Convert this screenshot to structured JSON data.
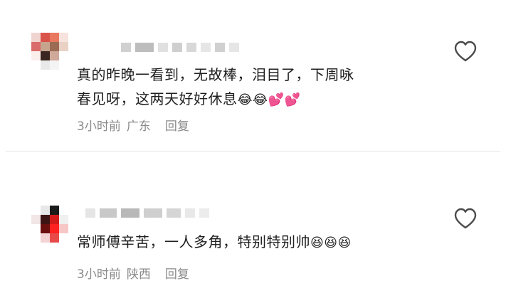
{
  "comments": [
    {
      "text_line1": "真的昨晚一看到，无故棒，泪目了，下周咏",
      "text_line2": "春见呀，这两天好好休息",
      "emojis": [
        "😂",
        "😂",
        "💕",
        "💕"
      ],
      "time": "3小时前",
      "location": "广东",
      "reply": "回复",
      "icons": {
        "like": "heart-outline-icon",
        "avatar": "pixelated-avatar"
      }
    },
    {
      "text_line1": "常师傅辛苦，一人多角，特别特别帅",
      "text_line2": "",
      "emojis": [
        "😆",
        "😆",
        "😆"
      ],
      "time": "3小时前",
      "location": "陕西",
      "reply": "回复",
      "icons": {
        "like": "heart-outline-icon",
        "avatar": "pixelated-avatar"
      }
    }
  ],
  "colors": {
    "text": "#1f1f1f",
    "meta": "#8a8a8a",
    "divider": "#e6e6e6"
  }
}
